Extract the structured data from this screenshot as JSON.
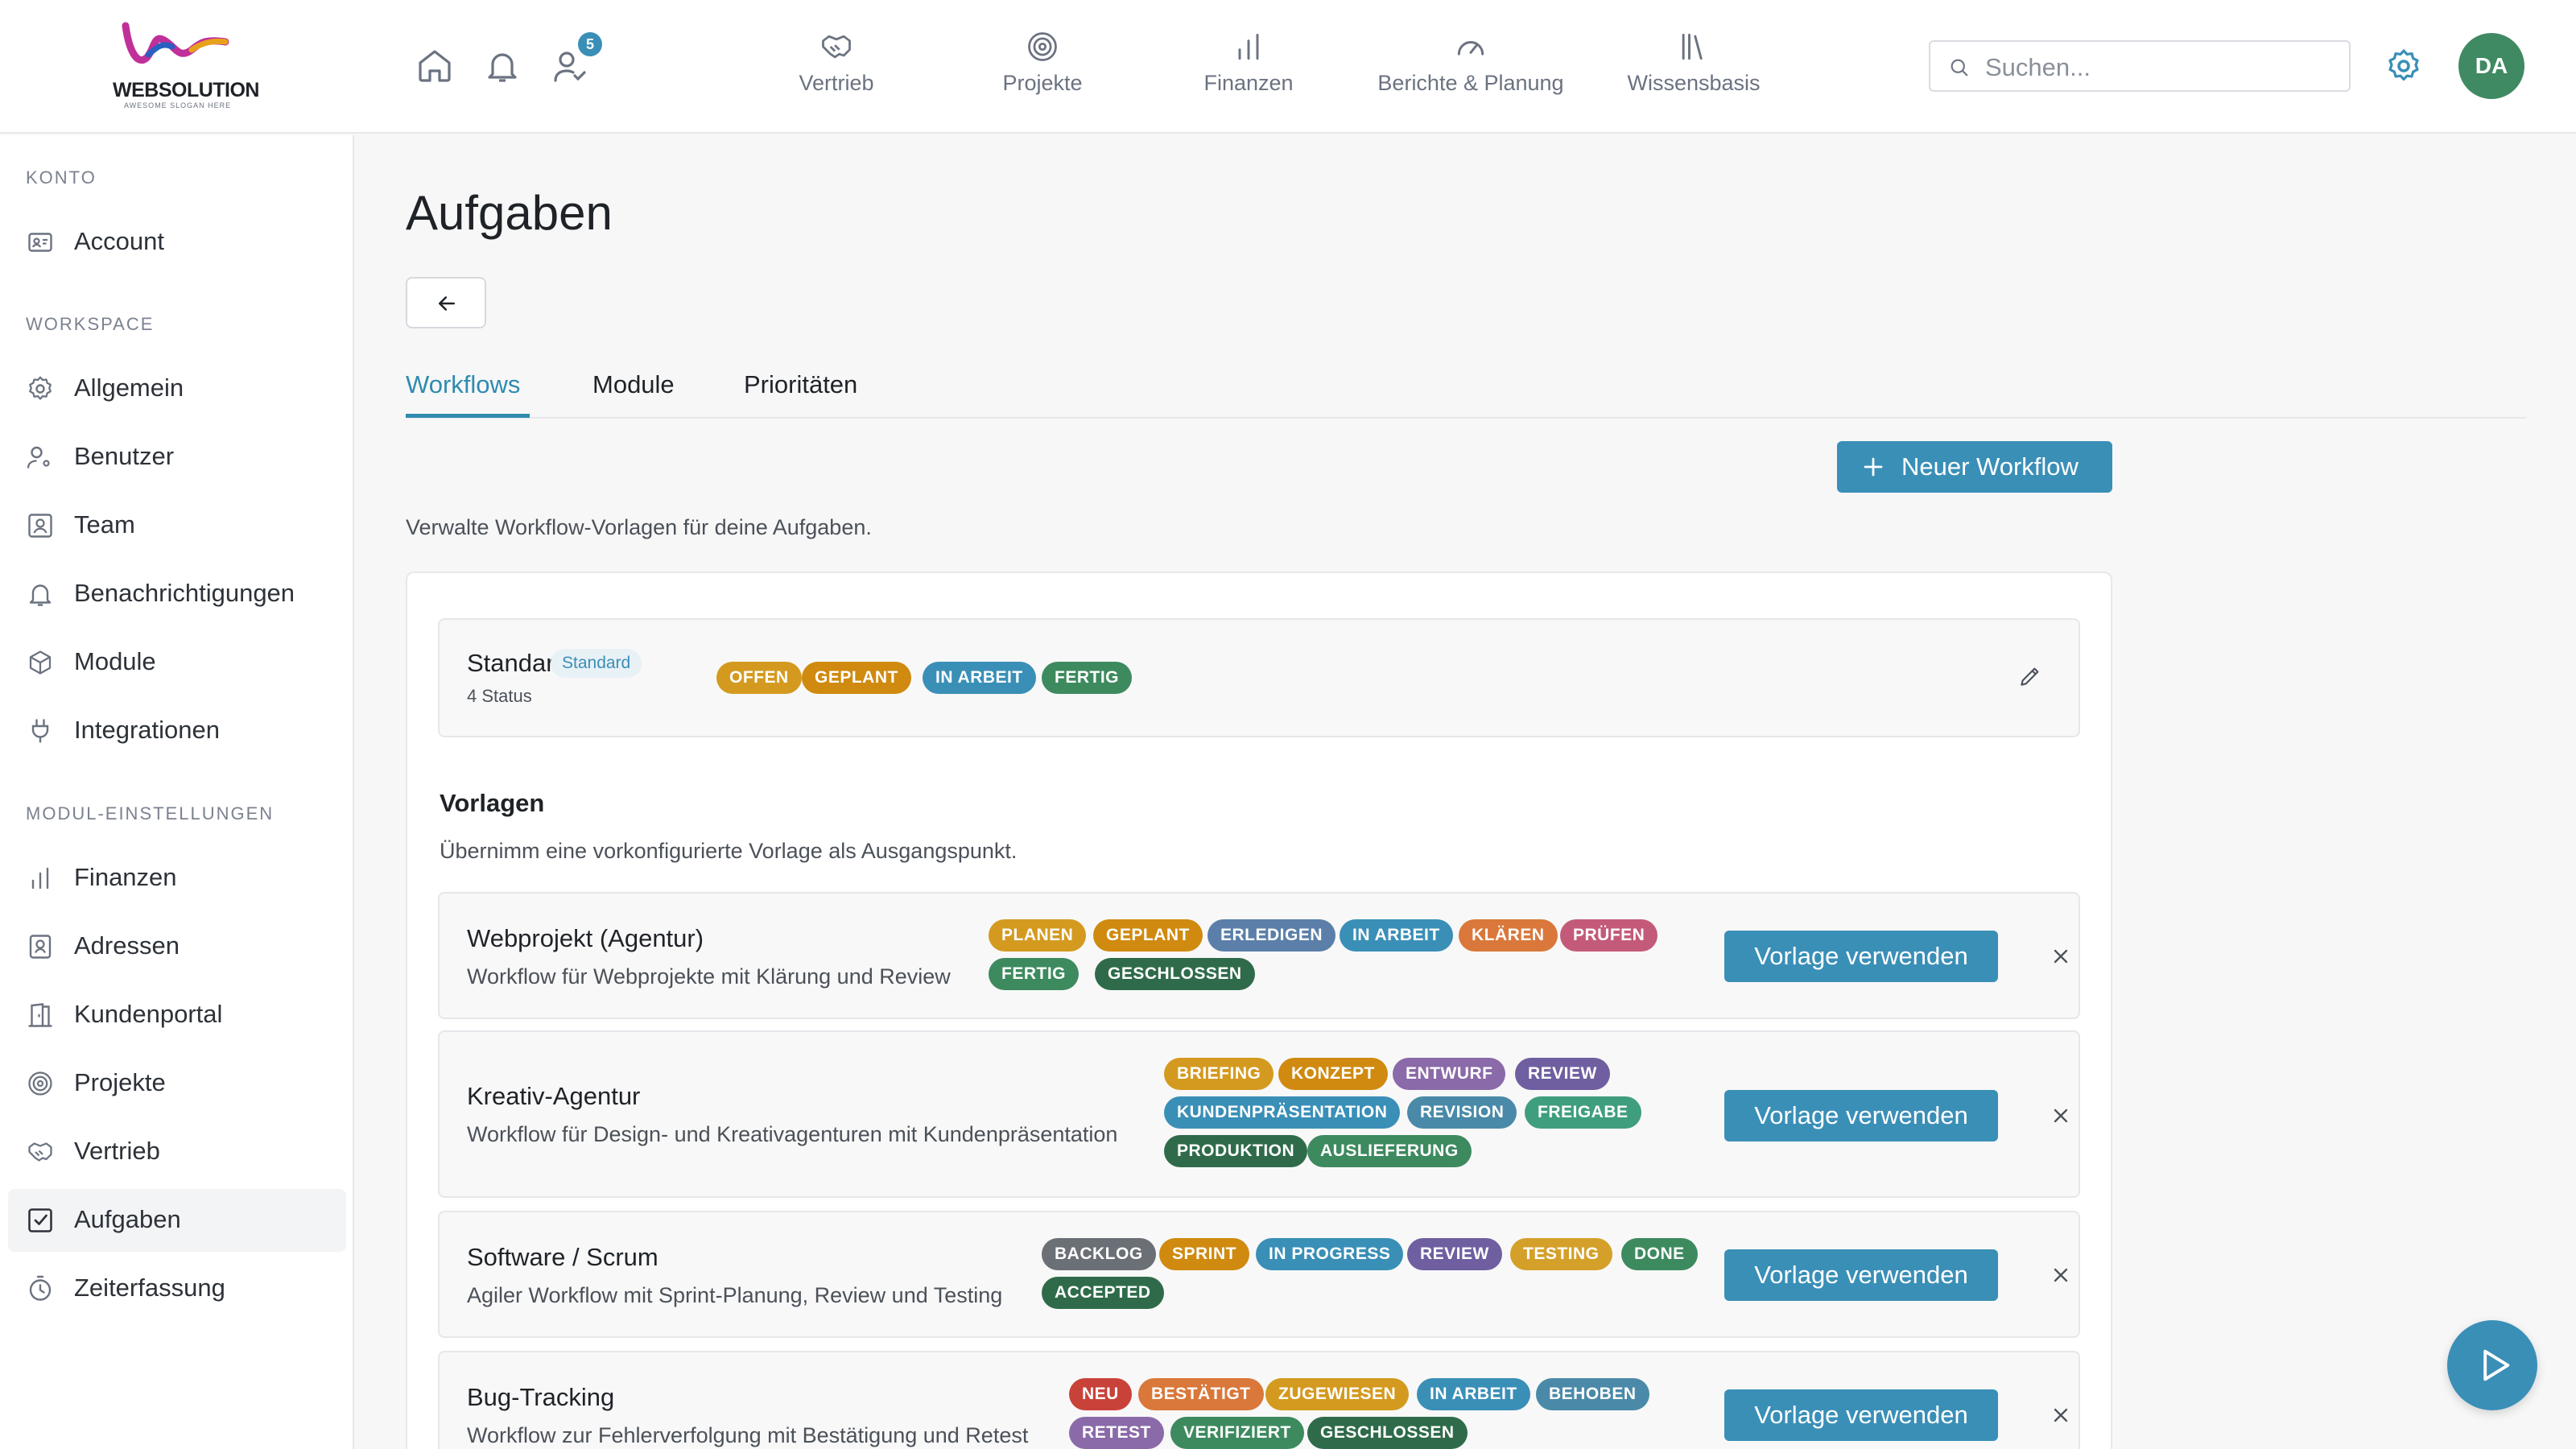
{
  "brand": {
    "name": "WEBSOLUTION",
    "slogan": "AWESOME SLOGAN HERE"
  },
  "topbar": {
    "notification_count": "5",
    "nav": [
      {
        "label": "Vertrieb",
        "icon": "handshake-icon"
      },
      {
        "label": "Projekte",
        "icon": "target-icon"
      },
      {
        "label": "Finanzen",
        "icon": "bar-chart-icon"
      },
      {
        "label": "Berichte & Planung",
        "icon": "gauge-icon"
      },
      {
        "label": "Wissensbasis",
        "icon": "library-icon"
      }
    ],
    "search_placeholder": "Suchen...",
    "avatar_initials": "DA"
  },
  "sidebar": {
    "sections": [
      {
        "label": "KONTO",
        "items": [
          {
            "label": "Account",
            "icon": "id-card-icon"
          }
        ]
      },
      {
        "label": "WORKSPACE",
        "items": [
          {
            "label": "Allgemein",
            "icon": "gear-icon"
          },
          {
            "label": "Benutzer",
            "icon": "user-gear-icon"
          },
          {
            "label": "Team",
            "icon": "team-icon"
          },
          {
            "label": "Benachrichtigungen",
            "icon": "bell-icon"
          },
          {
            "label": "Module",
            "icon": "package-icon"
          },
          {
            "label": "Integrationen",
            "icon": "plug-icon"
          }
        ]
      },
      {
        "label": "MODUL-EINSTELLUNGEN",
        "items": [
          {
            "label": "Finanzen",
            "icon": "bar-chart-icon"
          },
          {
            "label": "Adressen",
            "icon": "address-book-icon"
          },
          {
            "label": "Kundenportal",
            "icon": "door-icon"
          },
          {
            "label": "Projekte",
            "icon": "target-icon"
          },
          {
            "label": "Vertrieb",
            "icon": "handshake-icon"
          },
          {
            "label": "Aufgaben",
            "icon": "checkbox-icon",
            "active": true
          },
          {
            "label": "Zeiterfassung",
            "icon": "timer-icon"
          }
        ]
      }
    ]
  },
  "main": {
    "title": "Aufgaben",
    "tabs": [
      {
        "label": "Workflows",
        "active": true
      },
      {
        "label": "Module"
      },
      {
        "label": "Prioritäten"
      }
    ],
    "new_workflow_label": "Neuer Workflow",
    "description": "Verwalte Workflow-Vorlagen für deine Aufgaben.",
    "standard": {
      "name": "Standard",
      "badge": "Standard",
      "count": "4 Status",
      "statuses": [
        {
          "label": "OFFEN",
          "color": "#d49a1f"
        },
        {
          "label": "GEPLANT",
          "color": "#cf8a0f"
        },
        {
          "label": "IN ARBEIT",
          "color": "#3a8fb7"
        },
        {
          "label": "FERTIG",
          "color": "#3d8a5f"
        }
      ]
    },
    "templates_title": "Vorlagen",
    "templates_desc": "Übernimm eine vorkonfigurierte Vorlage als Ausgangspunkt.",
    "use_label": "Vorlage verwenden",
    "templates": [
      {
        "name": "Webprojekt (Agentur)",
        "desc": "Workflow für Webprojekte mit Klärung und Review",
        "statuses": [
          {
            "label": "PLANEN",
            "color": "#d49a1f"
          },
          {
            "label": "GEPLANT",
            "color": "#cf8a0f"
          },
          {
            "label": "ERLEDIGEN",
            "color": "#5b7fa8"
          },
          {
            "label": "IN ARBEIT",
            "color": "#3a8fb7"
          },
          {
            "label": "KLÄREN",
            "color": "#d9783a"
          },
          {
            "label": "PRÜFEN",
            "color": "#c45a79"
          },
          {
            "label": "FERTIG",
            "color": "#3d8a5f"
          },
          {
            "label": "GESCHLOSSEN",
            "color": "#2f6b4a"
          }
        ]
      },
      {
        "name": "Kreativ-Agentur",
        "desc": "Workflow für Design- und Kreativagenturen mit Kundenpräsentation",
        "statuses": [
          {
            "label": "BRIEFING",
            "color": "#d49a1f"
          },
          {
            "label": "KONZEPT",
            "color": "#cf8a0f"
          },
          {
            "label": "ENTWURF",
            "color": "#8a6aa8"
          },
          {
            "label": "REVIEW",
            "color": "#6f5fa0"
          },
          {
            "label": "KUNDENPRÄSENTATION",
            "color": "#3a8fb7"
          },
          {
            "label": "REVISION",
            "color": "#4a8aa8"
          },
          {
            "label": "FREIGABE",
            "color": "#3f9e7e"
          },
          {
            "label": "PRODUKTION",
            "color": "#2f6b4a"
          },
          {
            "label": "AUSLIEFERUNG",
            "color": "#3d8a5f"
          }
        ]
      },
      {
        "name": "Software / Scrum",
        "desc": "Agiler Workflow mit Sprint-Planung, Review und Testing",
        "statuses": [
          {
            "label": "BACKLOG",
            "color": "#6b6f76"
          },
          {
            "label": "SPRINT",
            "color": "#cf8a0f"
          },
          {
            "label": "IN PROGRESS",
            "color": "#3a8fb7"
          },
          {
            "label": "REVIEW",
            "color": "#6f5fa0"
          },
          {
            "label": "TESTING",
            "color": "#d4a02a"
          },
          {
            "label": "DONE",
            "color": "#3d8a5f"
          },
          {
            "label": "ACCEPTED",
            "color": "#2f6b4a"
          }
        ]
      },
      {
        "name": "Bug-Tracking",
        "desc": "Workflow zur Fehlerverfolgung mit Bestätigung und Retest",
        "statuses": [
          {
            "label": "NEU",
            "color": "#c9423a"
          },
          {
            "label": "BESTÄTIGT",
            "color": "#d9783a"
          },
          {
            "label": "ZUGEWIESEN",
            "color": "#d49a1f"
          },
          {
            "label": "IN ARBEIT",
            "color": "#3a8fb7"
          },
          {
            "label": "BEHOBEN",
            "color": "#4a8aa8"
          },
          {
            "label": "RETEST",
            "color": "#8a6aa8"
          },
          {
            "label": "VERIFIZIERT",
            "color": "#3d8a5f"
          },
          {
            "label": "GESCHLOSSEN",
            "color": "#2f6b4a"
          }
        ]
      }
    ]
  }
}
